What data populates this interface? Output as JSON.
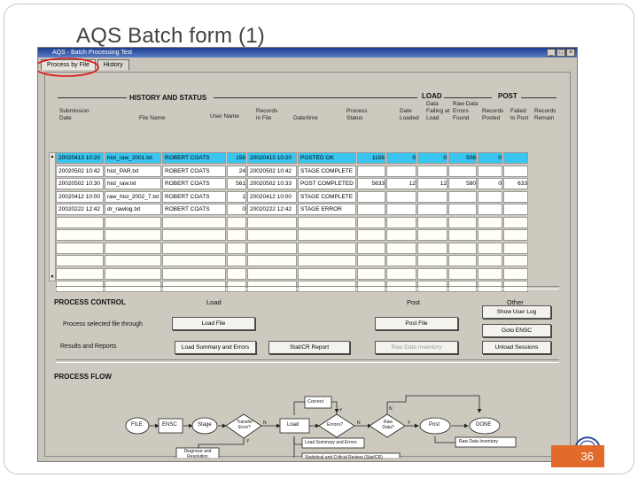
{
  "slide": {
    "title": "AQS Batch form (1)",
    "page_number": "36"
  },
  "window": {
    "title": "AQS - Batch Processing Test"
  },
  "tabs": [
    {
      "label": "Process by File"
    },
    {
      "label": "History"
    }
  ],
  "history": {
    "heading": "HISTORY AND STATUS",
    "load_heading": "LOAD",
    "post_heading": "POST",
    "columns": {
      "submission_date": "Submission Date",
      "file_name": "File Name",
      "user_name": "User Name",
      "records_in_file": "Records in File",
      "date_time": "Date/time",
      "process_status": "Process Status",
      "date_loaded": "Date Loaded",
      "data_failing_load": "Data Failing at Load",
      "raw_data_errors": "Raw Data Errors Found",
      "records_posted": "Records Posted",
      "failed_to_post": "Failed to Post",
      "records_remain": "Records Remain"
    },
    "rows": [
      {
        "date": "20020413 10:20",
        "file": "hist_raw_2001.txt",
        "user": "ROBERT COATS",
        "recs": "156",
        "dt": "20020413 10:20",
        "status": "POSTED OK",
        "loaded": "1156",
        "fail": "0",
        "err": "0",
        "posted": "508",
        "notposted": "0",
        "remain": ""
      },
      {
        "date": "20020502 10:42",
        "file": "hist_PAR.txt",
        "user": "ROBERT COATS",
        "recs": "24",
        "dt": "20020502 10:42",
        "status": "STAGE COMPLETE",
        "loaded": "",
        "fail": "",
        "err": "",
        "posted": "",
        "notposted": "",
        "remain": ""
      },
      {
        "date": "20020502 10:30",
        "file": "hist_raw.txt",
        "user": "ROBERT COATS",
        "recs": "561",
        "dt": "20020502 10:33",
        "status": "POST COMPLETED",
        "loaded": "5633",
        "fail": "12",
        "err": "12",
        "posted": "580",
        "notposted": "0",
        "remain": "633"
      },
      {
        "date": "20020412 10:00",
        "file": "raw_hist_2002_7.txt",
        "user": "ROBERT COATS",
        "recs": "1",
        "dt": "20020412 10:00",
        "status": "STAGE COMPLETE",
        "loaded": "",
        "fail": "",
        "err": "",
        "posted": "",
        "notposted": "",
        "remain": ""
      },
      {
        "date": "20020222 12:42",
        "file": "dr_rawlog.txt",
        "user": "ROBERT COATS",
        "recs": "0",
        "dt": "20020222 12:42",
        "status": "STAGE ERROR",
        "loaded": "",
        "fail": "",
        "err": "",
        "posted": "",
        "notposted": "",
        "remain": ""
      }
    ]
  },
  "process_control": {
    "heading": "PROCESS CONTROL",
    "load_heading": "Load",
    "post_heading": "Post",
    "other_heading": "Other",
    "row1_label": "Process selected file through",
    "row2_label": "Results and Reports",
    "buttons": {
      "load_file": "Load File",
      "post_file": "Post File",
      "show_user_log": "Show User Log",
      "goto_ensc": "Goto ENSC",
      "load_summary": "Load Summary and Errors",
      "stat_cr_report": "Stat/CR Report",
      "raw_data_inventory": "Raw Data Inventory",
      "unload_sessions": "Unload Sessions"
    }
  },
  "process_flow": {
    "heading": "PROCESS FLOW",
    "nodes": {
      "file": "FILE",
      "ensc": "ENSC",
      "stage": "Stage",
      "transfer_error": "Transfer Error?",
      "load": "Load",
      "errors": "Errors?",
      "raw_data": "Raw Data?",
      "post": "Post",
      "done": "DONE",
      "correct": "Correct",
      "diagnose": "Diagnose and Resolution",
      "load_summary": "Load Summary and Errors",
      "stat_review": "Statistical and Critical Review (Stat/CR)",
      "raw_inventory": "Raw Data Inventory"
    },
    "edge_labels": {
      "yes": "Y",
      "no": "N"
    }
  }
}
